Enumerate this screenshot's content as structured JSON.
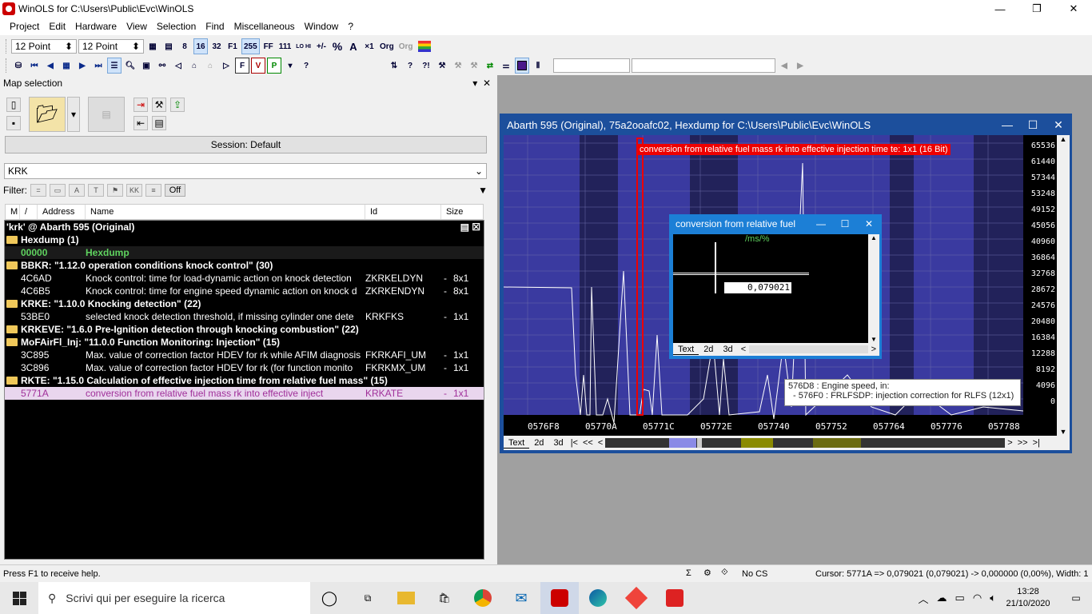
{
  "window": {
    "title": "WinOLS for C:\\Users\\Public\\Evc\\WinOLS"
  },
  "menu": [
    "Project",
    "Edit",
    "Hardware",
    "View",
    "Selection",
    "Find",
    "Miscellaneous",
    "Window",
    "?"
  ],
  "toolbar": {
    "font1": "12 Point",
    "font2": "12 Point",
    "btn_255": "255",
    "btn_ff": "FF",
    "btn_111": "111",
    "btn_8": "8",
    "btn_16": "16",
    "btn_32": "32",
    "btn_f1": "F1",
    "btn_lohi": "LO HI",
    "btn_org": "Org",
    "btn_org2": "Org",
    "btn_x1": "×1"
  },
  "left": {
    "header": "Map selection",
    "session": "Session: Default",
    "search_value": "KRK",
    "filter_label": "Filter:",
    "filter_off": "Off",
    "columns": [
      "M",
      "/",
      "Address",
      "Name",
      "Id",
      "Size"
    ],
    "list_title": "'krk' @ Abarth 595 (Original)",
    "rows": [
      {
        "kind": "group",
        "label": "Hexdump (1)"
      },
      {
        "kind": "hex",
        "addr": "00000",
        "name": "Hexdump",
        "id": "",
        "size": ""
      },
      {
        "kind": "group",
        "label": "BBKR: \"1.12.0    operation conditions knock control\" (30)"
      },
      {
        "kind": "item",
        "addr": "4C6AD",
        "name": "Knock control: time for load-dynamic action on knock detection",
        "id": "ZKRKELDYN",
        "size": "8x1"
      },
      {
        "kind": "item",
        "addr": "4C6B5",
        "name": "Knock control: time for engine speed dynamic action on knock d",
        "id": "ZKRKENDYN",
        "size": "8x1"
      },
      {
        "kind": "group",
        "label": "KRKE: \"1.10.0    Knocking detection\" (22)"
      },
      {
        "kind": "item",
        "addr": "53BE0",
        "name": "selected knock detection threshold, if missing cylinder one dete",
        "id": "KRKFKS",
        "size": "1x1"
      },
      {
        "kind": "group",
        "label": "KRKEVE: \"1.6.0     Pre-Ignition detection through knocking combustion\" (22)"
      },
      {
        "kind": "group",
        "label": "MoFAirFl_Inj: \"11.0.0    Function Monitoring: Injection\" (15)"
      },
      {
        "kind": "item",
        "addr": "3C895",
        "name": "Max. value of correction factor HDEV for rk while AFIM diagnosis",
        "id": "FKRKAFI_UM",
        "size": "1x1"
      },
      {
        "kind": "item",
        "addr": "3C896",
        "name": "Max. value of correction factor HDEV for rk (for function monito",
        "id": "FKRKMX_UM",
        "size": "1x1"
      },
      {
        "kind": "group",
        "label": "RKTE: \"1.15.0    Calculation of effective injection time from relative fuel mass\" (15)"
      },
      {
        "kind": "sel",
        "addr": "5771A",
        "name": "conversion from relative fuel mass rk into effective inject",
        "id": "KRKATE",
        "size": "1x1"
      }
    ]
  },
  "hexwin": {
    "title": "Abarth 595 (Original), 75a2ooafc02, Hexdump for C:\\Users\\Public\\Evc\\WinOLS",
    "red_label": "conversion from relative fuel mass rk into effective injection time te: 1x1 (16 Bit)",
    "scale": [
      "65536",
      "61440",
      "57344",
      "53248",
      "49152",
      "45056",
      "40960",
      "36864",
      "32768",
      "28672",
      "24576",
      "20480",
      "16384",
      "12288",
      "8192",
      "4096",
      "0"
    ],
    "xaddr": [
      "0576F8",
      "05770A",
      "05771C",
      "05772E",
      "057740",
      "057752",
      "057764",
      "057776",
      "057788"
    ],
    "tabs": [
      "Text",
      "2d",
      "3d"
    ],
    "tooltip_line1": "576D8 : Engine speed, in:",
    "tooltip_line2": "- 576F0 : FRLFSDP: injection correction for RLFS (12x1)"
  },
  "floatwin": {
    "title": "conversion from relative fuel",
    "unit": "/ms/%",
    "value": "0,079021",
    "tabs": [
      "Text",
      "2d",
      "3d"
    ]
  },
  "status": {
    "help": "Press F1 to receive help.",
    "cs": "No CS",
    "cursor": "Cursor: 5771A => 0,079021 (0,079021) -> 0,000000 (0,00%), Width: 1"
  },
  "taskbar": {
    "search_placeholder": "Scrivi qui per eseguire la ricerca",
    "time": "13:28",
    "date": "21/10/2020"
  }
}
